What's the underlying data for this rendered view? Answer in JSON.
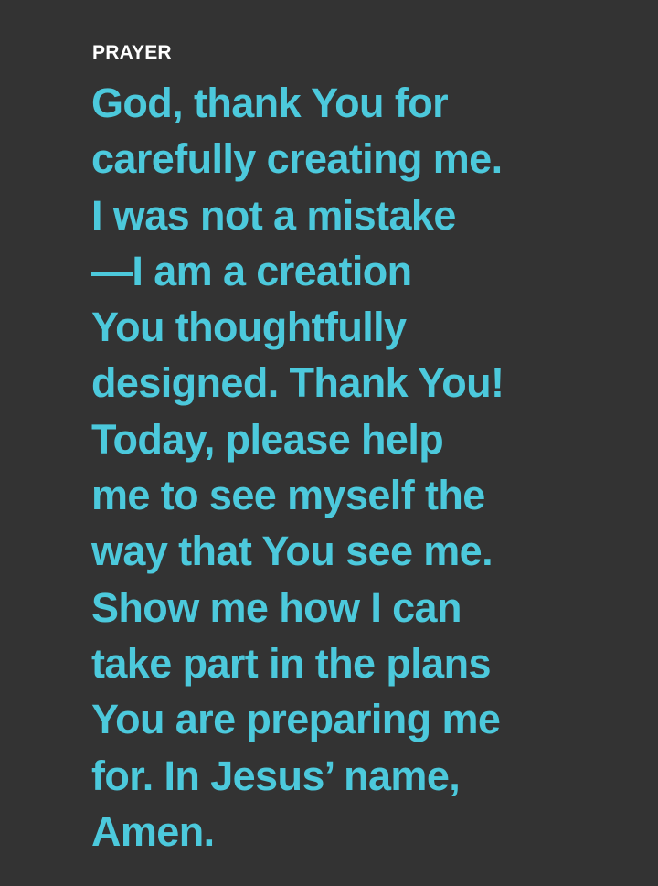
{
  "section": {
    "label": "PRAYER"
  },
  "prayer": {
    "lines": [
      "God, thank You for",
      "carefully creating me.",
      "I was not a mistake",
      "—I am a creation",
      "You thoughtfully",
      "designed. Thank You!",
      "Today, please help",
      "me to see myself the",
      "way that You see me.",
      "Show me how I can",
      "take part in the plans",
      "You are preparing me",
      "for. In Jesus’ name,",
      "Amen."
    ]
  },
  "colors": {
    "background": "#333333",
    "label": "#ffffff",
    "prayer_text": "#4cc9dc"
  }
}
